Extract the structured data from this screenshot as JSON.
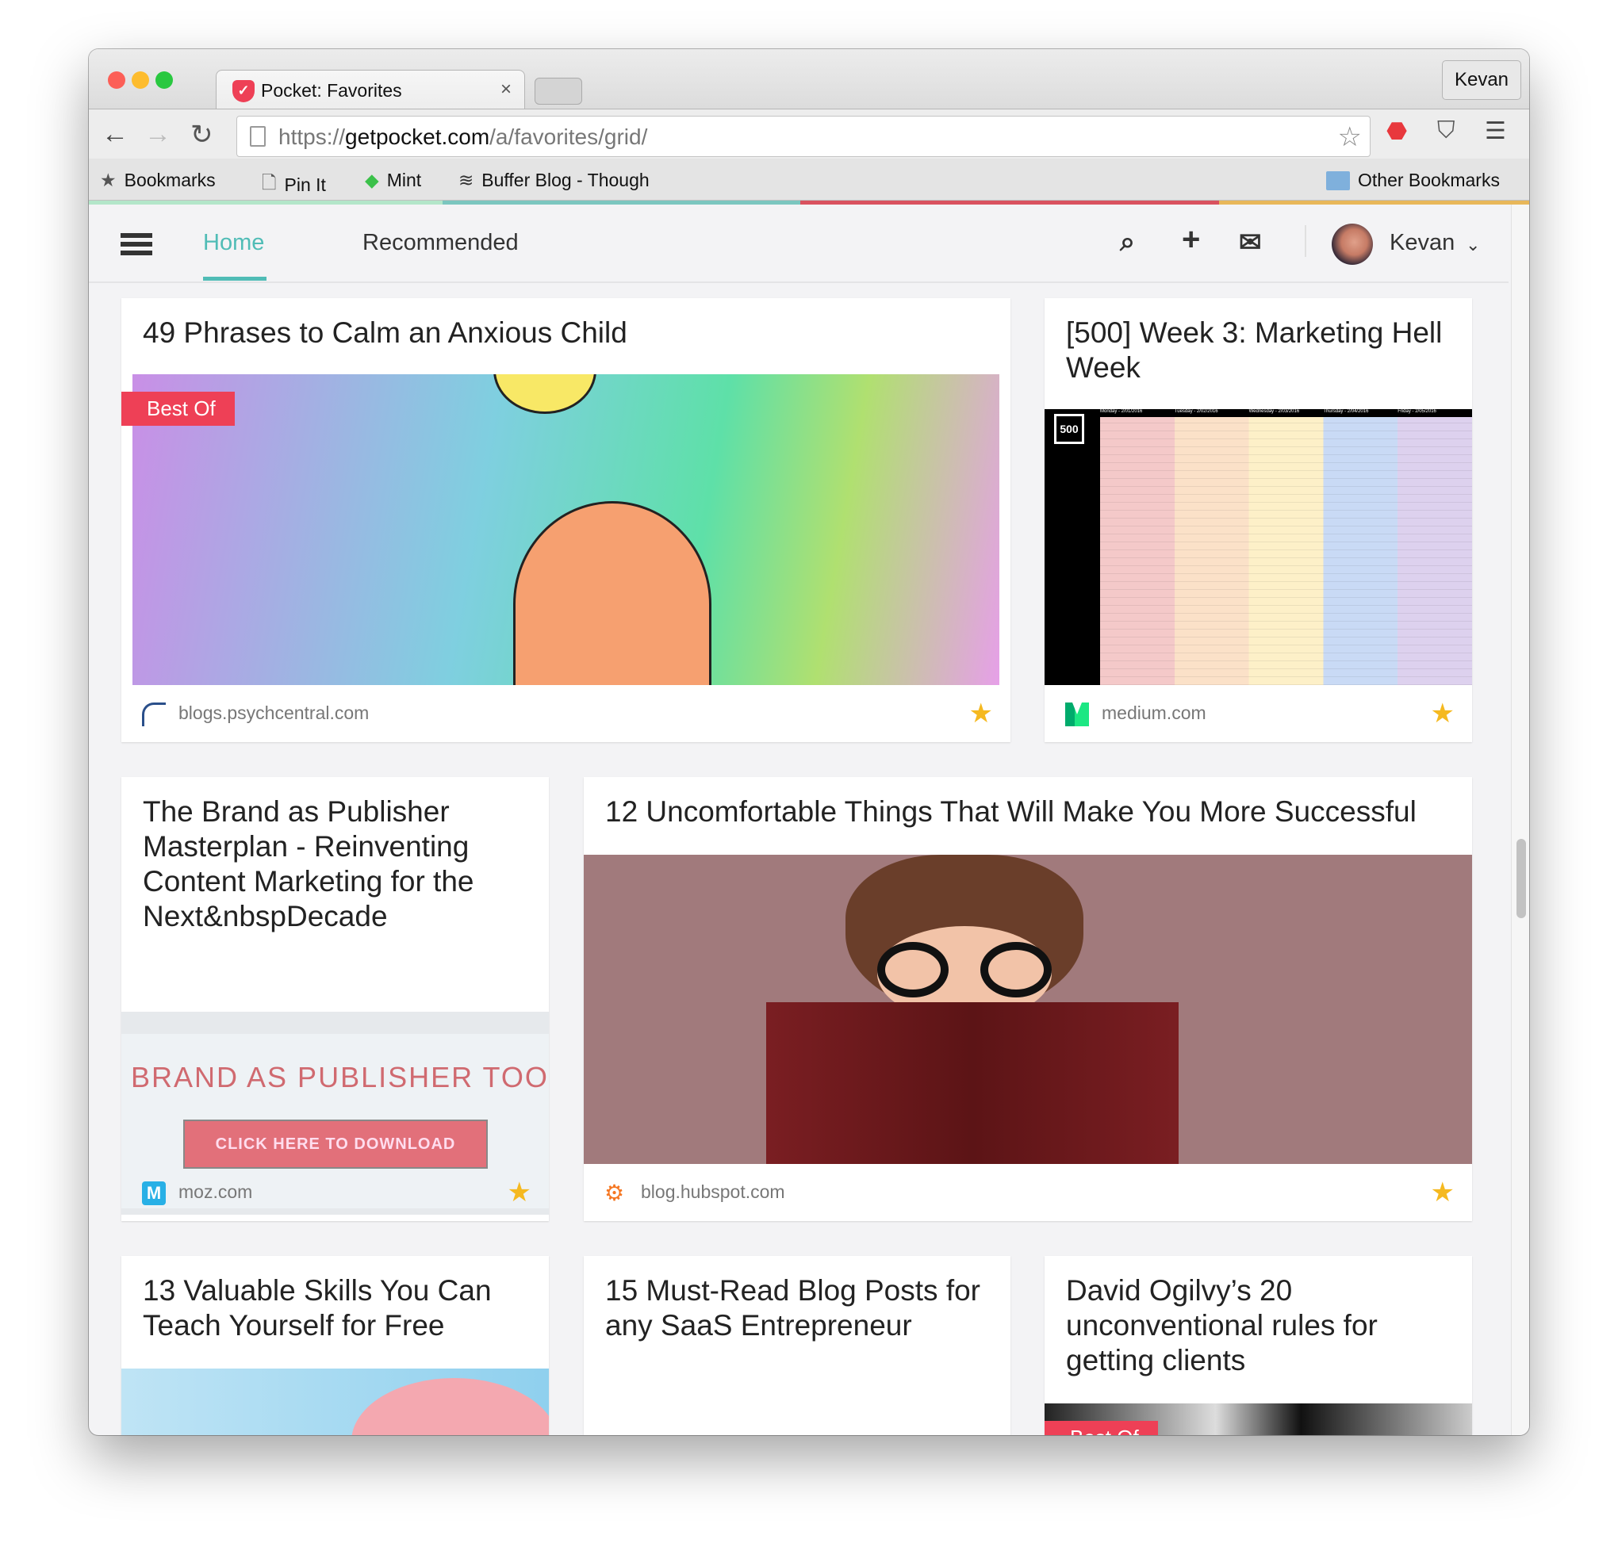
{
  "browser": {
    "tab_title": "Pocket: Favorites",
    "profile": "Kevan",
    "url_prefix": "https://",
    "url_domain": "getpocket.com",
    "url_path": "/a/favorites/grid/",
    "bookmarks": [
      "Bookmarks",
      "Pin It",
      "Mint",
      "Buffer Blog - Though"
    ],
    "other_bookmarks": "Other Bookmarks"
  },
  "header": {
    "tabs": [
      "Home",
      "Recommended"
    ],
    "user": "Kevan",
    "strip_colors": [
      "#b3e6c9",
      "#7bc6bf",
      "#d9525f",
      "#e8b75a"
    ]
  },
  "badge_label": "Best Of",
  "cards": [
    {
      "title": "49 Phrases to Calm an Anxious Child",
      "domain": "blogs.psychcentral.com",
      "favorited": true,
      "badge": true
    },
    {
      "title": "[500] Week 3: Marketing Hell Week",
      "domain": "medium.com",
      "favorited": true,
      "image_text": "500",
      "days": [
        "Monday - 2/01/2016",
        "Tuesday - 2/02/2016",
        "Wednesday - 2/03/2016",
        "Thursday - 2/04/2016",
        "Friday - 2/05/2016"
      ]
    },
    {
      "title": "The Brand as Publisher Masterplan - Reinventing Content Marketing for the Next&nbspDecade",
      "domain": "moz.com",
      "favorited": true,
      "image_heading": "BRAND AS PUBLISHER TOOL",
      "image_button": "CLICK HERE TO DOWNLOAD"
    },
    {
      "title": "12 Uncomfortable Things That Will Make You More Successful",
      "domain": "blog.hubspot.com",
      "favorited": true
    },
    {
      "title": "13 Valuable Skills You Can Teach Yourself for Free"
    },
    {
      "title": "15 Must-Read Blog Posts for any SaaS Entrepreneur"
    },
    {
      "title": "David Ogilvy’s 20 unconventional rules for getting clients",
      "badge": true
    }
  ]
}
